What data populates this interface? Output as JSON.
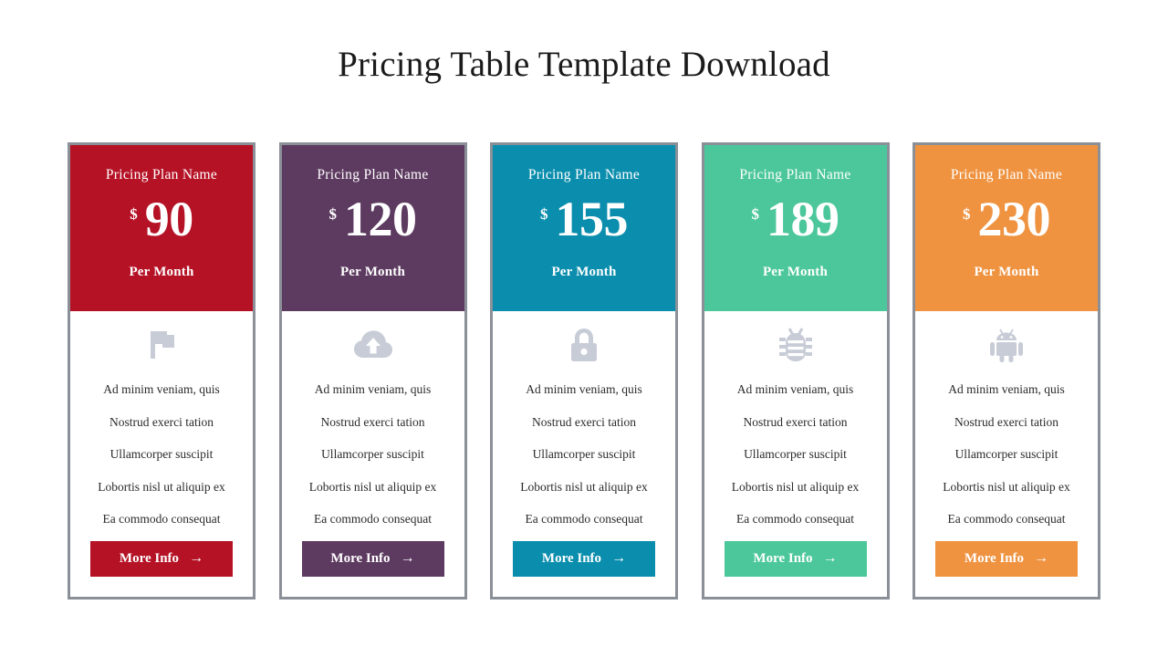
{
  "page": {
    "title": "Pricing Table Template Download",
    "background": "#ffffff",
    "border_color": "#8a8f98",
    "icon_color": "#c7ccd6",
    "feature_text_color": "#2b2b2b"
  },
  "common": {
    "plan_name": "Pricing Plan Name",
    "currency": "$",
    "period": "Per Month",
    "button_label": "More Info",
    "button_arrow": "→",
    "features": [
      "Ad minim veniam, quis",
      "Nostrud exerci tation",
      "Ullamcorper suscipit",
      "Lobortis nisl ut aliquip ex",
      "Ea commodo consequat"
    ]
  },
  "plans": [
    {
      "plan_name": "Pricing Plan Name",
      "currency": "$",
      "price": "90",
      "period": "Per Month",
      "color": "#b51225",
      "icon": "flag-icon",
      "button_label": "More Info",
      "button_arrow": "→",
      "features": [
        "Ad minim veniam, quis",
        "Nostrud exerci tation",
        "Ullamcorper suscipit",
        "Lobortis nisl ut aliquip ex",
        "Ea commodo consequat"
      ]
    },
    {
      "plan_name": "Pricing Plan Name",
      "currency": "$",
      "price": "120",
      "period": "Per Month",
      "color": "#5d3a60",
      "icon": "cloud-upload-icon",
      "button_label": "More Info",
      "button_arrow": "→",
      "features": [
        "Ad minim veniam, quis",
        "Nostrud exerci tation",
        "Ullamcorper suscipit",
        "Lobortis nisl ut aliquip ex",
        "Ea commodo consequat"
      ]
    },
    {
      "plan_name": "Pricing Plan Name",
      "currency": "$",
      "price": "155",
      "period": "Per Month",
      "color": "#0b8ead",
      "icon": "lock-icon",
      "button_label": "More Info",
      "button_arrow": "→",
      "features": [
        "Ad minim veniam, quis",
        "Nostrud exerci tation",
        "Ullamcorper suscipit",
        "Lobortis nisl ut aliquip ex",
        "Ea commodo consequat"
      ]
    },
    {
      "plan_name": "Pricing Plan Name",
      "currency": "$",
      "price": "189",
      "period": "Per Month",
      "color": "#4cc79c",
      "icon": "bug-icon",
      "button_label": "More Info",
      "button_arrow": "→",
      "features": [
        "Ad minim veniam, quis",
        "Nostrud exerci tation",
        "Ullamcorper suscipit",
        "Lobortis nisl ut aliquip ex",
        "Ea commodo consequat"
      ]
    },
    {
      "plan_name": "Pricing Plan Name",
      "currency": "$",
      "price": "230",
      "period": "Per Month",
      "color": "#ef9341",
      "icon": "android-icon",
      "button_label": "More Info",
      "button_arrow": "→",
      "features": [
        "Ad minim veniam, quis",
        "Nostrud exerci tation",
        "Ullamcorper suscipit",
        "Lobortis nisl ut aliquip ex",
        "Ea commodo consequat"
      ]
    }
  ]
}
